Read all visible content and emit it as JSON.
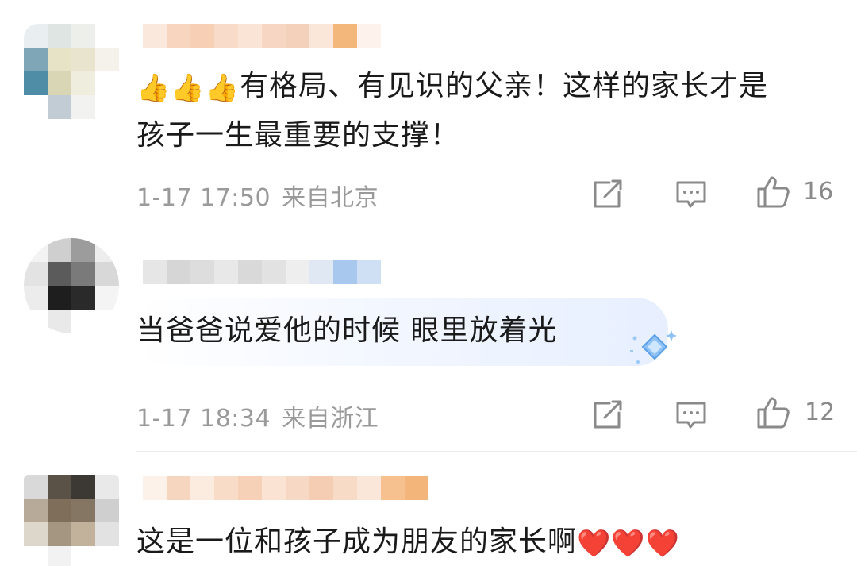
{
  "comments": [
    {
      "emojis": [
        "👍",
        "👍",
        "👍"
      ],
      "text_line1": "有格局、有见识的父亲！这样的家长才是",
      "text_line2": "孩子一生最重要的支撑！",
      "time": "1-17 17:50",
      "location": "来自北京",
      "likes": "16",
      "forward_icon": "forward-icon",
      "reply_icon": "comment-icon",
      "like_icon": "thumbs-up-icon"
    },
    {
      "text": "当爸爸说爱他的时候 眼里放着光",
      "time": "1-17 18:34",
      "location": "来自浙江",
      "likes": "12",
      "badge_icon": "diamond-sparkle-icon"
    },
    {
      "text": "这是一位和孩子成为朋友的家长啊",
      "emojis": [
        "❤️",
        "❤️",
        "❤️"
      ]
    }
  ],
  "colors": {
    "text": "#1a1a1a",
    "meta": "#9a9a9a",
    "icon": "#8a8a8a",
    "heart": "#e5332a",
    "bubble_accent": "#e7efff"
  }
}
